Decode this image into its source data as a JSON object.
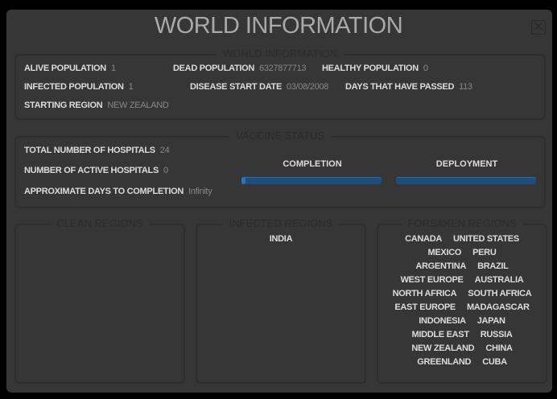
{
  "title": "WORLD INFORMATION",
  "close_icon": "close-icon",
  "world": {
    "legend": "WORLD INFORMATION",
    "fields": [
      {
        "label": "ALIVE POPULATION",
        "value": "1"
      },
      {
        "label": "DEAD POPULATION",
        "value": "6327877713"
      },
      {
        "label": "HEALTHY POPULATION",
        "value": "0"
      },
      {
        "label": "INFECTED POPULATION",
        "value": "1"
      },
      {
        "label": "DISEASE START DATE",
        "value": "03/08/2008"
      },
      {
        "label": "DAYS THAT HAVE PASSED",
        "value": "113"
      },
      {
        "label": "STARTING REGION",
        "value": "NEW ZEALAND"
      }
    ]
  },
  "vaccine": {
    "legend": "VACCINE STATUS",
    "fields": [
      {
        "label": "TOTAL NUMBER OF HOSPITALS",
        "value": "24"
      },
      {
        "label": "NUMBER OF ACTIVE HOSPITALS",
        "value": "0"
      },
      {
        "label": "APPROXIMATE DAYS TO COMPLETION",
        "value": "Infinity"
      }
    ],
    "completion_label": "COMPLETION",
    "completion_pct": 3,
    "deployment_label": "DEPLOYMENT",
    "deployment_pct": 0,
    "bar_color": "#2b73c0"
  },
  "regions": {
    "clean": {
      "legend": "CLEAN REGIONS",
      "items": []
    },
    "infected": {
      "legend": "INFECTED REGIONS",
      "items": [
        "INDIA"
      ]
    },
    "forsaken": {
      "legend": "FORSAKEN REGIONS",
      "items": [
        "CANADA",
        "UNITED STATES",
        "MEXICO",
        "PERU",
        "ARGENTINA",
        "BRAZIL",
        "WEST EUROPE",
        "AUSTRALIA",
        "NORTH AFRICA",
        "SOUTH AFRICA",
        "EAST EUROPE",
        "MADAGASCAR",
        "INDONESIA",
        "JAPAN",
        "MIDDLE EAST",
        "RUSSIA",
        "NEW ZEALAND",
        "CHINA",
        "GREENLAND",
        "CUBA"
      ]
    }
  }
}
